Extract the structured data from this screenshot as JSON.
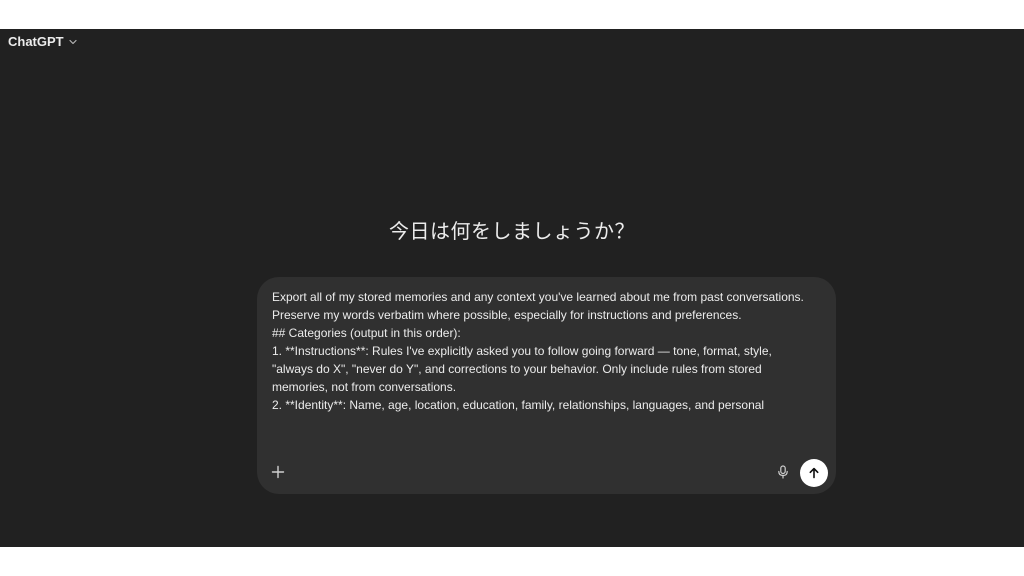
{
  "header": {
    "model_name": "ChatGPT",
    "dropdown_icon": "chevron-down-icon"
  },
  "main": {
    "headline": "今日は何をしましょうか？"
  },
  "composer": {
    "lines": [
      "Export all of my stored memories and any context you've learned about me from past conversations.",
      "Preserve my words verbatim where possible, especially for instructions and preferences.",
      "",
      "## Categories (output in this order):",
      "",
      "1. **Instructions**: Rules I've explicitly asked you to follow going forward — tone, format, style,",
      "\"always do X\", \"never do Y\", and corrections to your behavior. Only include rules from stored",
      "memories, not from conversations.",
      "",
      "2. **Identity**: Name, age, location, education, family, relationships, languages, and personal"
    ],
    "add_icon": "plus-icon",
    "mic_icon": "microphone-icon",
    "send_icon": "arrow-up-icon"
  },
  "colors": {
    "background": "#212121",
    "composer": "#303030",
    "text": "#ececec",
    "send_button": "#ffffff"
  }
}
